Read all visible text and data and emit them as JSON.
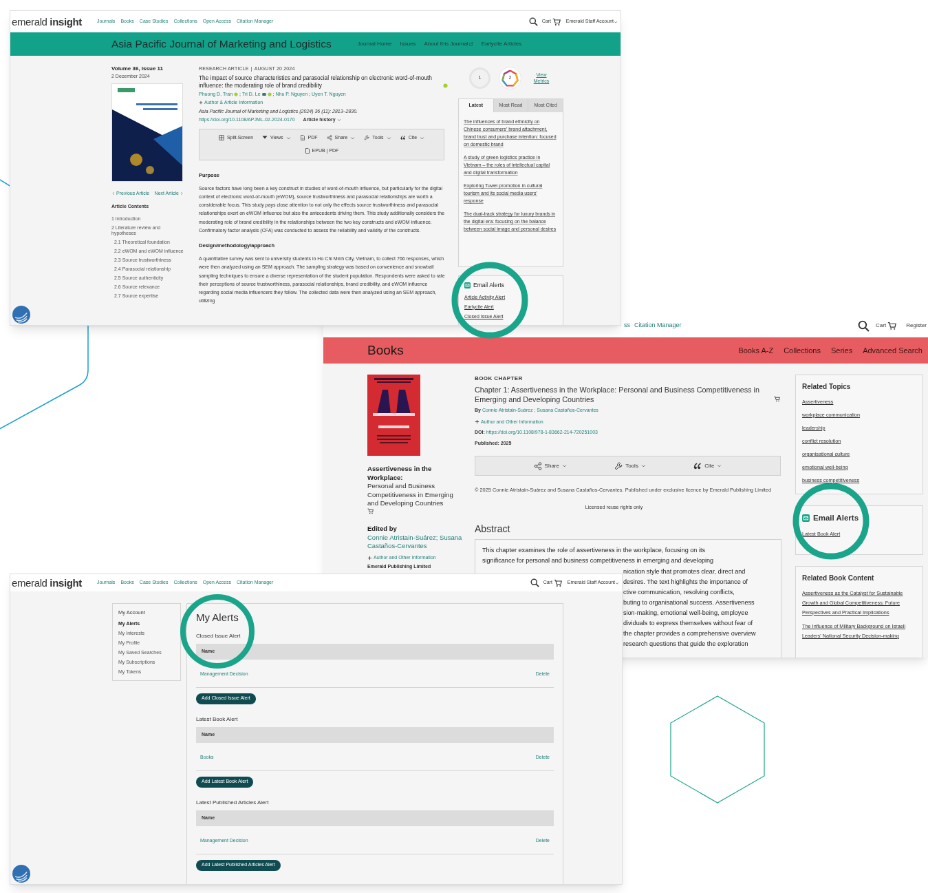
{
  "journal_window": {
    "header": {
      "logo": "emerald **insight**",
      "nav": [
        "Journals",
        "Books",
        "Case Studies",
        "Collections",
        "Open Access",
        "Citation Manager"
      ],
      "cart": "Cart",
      "account": "Emerald Staff Account"
    },
    "banner": {
      "title": "Asia Pacific Journal of Marketing and Logistics",
      "nav": [
        {
          "label": "Journal Home",
          "external": false
        },
        {
          "label": "Issues",
          "external": false
        },
        {
          "label": "About this Journal",
          "external": true
        },
        {
          "label": "Earlycite Articles",
          "external": false
        }
      ]
    },
    "issue": {
      "volume": "Volume 36, Issue 11",
      "date": "2 December 2024"
    },
    "article_nav": {
      "previous": "Previous Article",
      "next": "Next Article"
    },
    "contents": {
      "heading": "Article Contents",
      "items": [
        {
          "label": "1 Introduction"
        },
        {
          "label": "2 Literature review and hypotheses",
          "children": [
            {
              "label": "2.1 Theoretical foundation"
            },
            {
              "label": "2.2 eWOM and eWOM influence"
            },
            {
              "label": "2.3 Source trustworthiness"
            },
            {
              "label": "2.4 Parasocial relationship"
            },
            {
              "label": "2.5 Source authenticity"
            },
            {
              "label": "2.6 Source relevance"
            },
            {
              "label": "2.7 Source expertise"
            }
          ]
        }
      ]
    },
    "article": {
      "type": "RESEARCH ARTICLE",
      "divider": "|",
      "date": "AUGUST 20 2024",
      "title": "The impact of source characteristics and parasocial relationship on electronic word-of-mouth influence: the moderating role of brand credibility",
      "authors": [
        {
          "name": "Phuong D. Tran",
          "orcid": true,
          "email": false,
          "separator": ";"
        },
        {
          "name": "Tri D. Le",
          "orcid": true,
          "email": true,
          "separator": ";"
        },
        {
          "name": "Nhu P. Nguyen",
          "orcid": false,
          "email": false,
          "separator": ";"
        },
        {
          "name": "Uyen T. Nguyen",
          "orcid": false,
          "email": false
        }
      ],
      "author_info": "Author & Article Information",
      "citation": "Asia Pacific Journal of Marketing and Logistics (2024) 36 (11): 2813–2830.",
      "doi": "https://doi.org/10.1108/APJML-02-2024-0170",
      "history": "Article history",
      "toolbar": [
        {
          "kind": "split",
          "label": "Split-Screen",
          "dropdown": false
        },
        {
          "kind": "views",
          "label": "Views",
          "dropdown": true
        },
        {
          "kind": "pdf",
          "label": "PDF",
          "dropdown": false
        },
        {
          "kind": "share",
          "label": "Share",
          "dropdown": true
        },
        {
          "kind": "tools",
          "label": "Tools",
          "dropdown": true
        },
        {
          "kind": "cite",
          "label": "Cite",
          "dropdown": true
        }
      ],
      "formats": "EPUB | PDF",
      "sections": [
        {
          "heading": "Purpose",
          "text": "Source factors have long been a key construct in studies of word-of-mouth influence, but particularly for the digital context of electronic word-of-mouth (eWOM), source trustworthiness and parasocial relationships are worth a considerable focus. This study pays close attention to not only the effects source trustworthiness and parasocial relationships exert on eWOM influence but also the antecedents driving them. This study additionally considers the moderating role of brand credibility in the relationships between the two key constructs and eWOM influence. Confirmatory factor analysis (CFA) was conducted to assess the reliability and validity of the constructs."
        },
        {
          "heading": "Design/methodology/approach",
          "text": "A quantitative survey was sent to university students in Ho Chi Minh City, Vietnam, to collect 766 responses, which were then analyzed using an SEM approach. The sampling strategy was based on convenience and snowball sampling techniques to ensure a diverse representation of the student population. Respondents were asked to rate their perceptions of source trustworthiness, parasocial relationships, brand credibility, and eWOM influence regarding social media influencers they follow. The collected data were then analyzed using an SEM approach, utilizing"
        }
      ]
    },
    "metrics": {
      "citations": "1",
      "attention": "2",
      "link": "View Metrics"
    },
    "tabs": [
      {
        "label": "Latest",
        "selected": true
      },
      {
        "label": "Most Read",
        "selected": false
      },
      {
        "label": "Most Cited",
        "selected": false
      }
    ],
    "latest": [
      "The influences of brand ethnicity on Chinese consumers' brand attachment, brand trust and purchase intention: focused on domestic brand",
      "A study of green logistics practice in Vietnam – the roles of intellectual capital and digital transformation",
      "Exploring Tuwei promotion in cultural tourism and its social media users' response",
      "The dual-track strategy for luxury brands in the digital era: focusing on the balance between social image and personal desires"
    ],
    "email_alerts": {
      "title": "Email Alerts",
      "links": [
        "Article Activity Alert",
        "Earlycite Alert",
        "Closed Issue Alert"
      ]
    }
  },
  "books_window": {
    "header": {
      "nav": [
        "ss",
        "Citation Manager"
      ],
      "cart": "Cart",
      "account": "Register"
    },
    "banner": {
      "title": "Books",
      "nav": [
        "Books A-Z",
        "Collections",
        "Series",
        "Advanced Search"
      ]
    },
    "book": {
      "title": "Assertiveness in the Workplace:",
      "subtitle": "Personal and Business Competitiveness in Emerging and Developing Countries",
      "edited_by": "Edited by",
      "editors": "Connie Atristain-Suárez; Susana Castaños-Cervantes",
      "author_info": "Author and Other Information",
      "publisher": "Emerald Publishing Limited"
    },
    "chapter": {
      "type": "BOOK CHAPTER",
      "title": "Chapter 1: Assertiveness in the Workplace: Personal and Business Competitiveness in Emerging and Developing Countries",
      "by": "By",
      "authors": "Connie Atristain-Suárez ; Susana Castaños-Cervantes",
      "author_info": "Author and Other Information",
      "doi_label": "DOI:",
      "doi": "https://doi.org/10.1108/978-1-83662-214-720251003",
      "published_label": "Published:",
      "published": "2025",
      "toolbar": [
        {
          "kind": "share",
          "label": "Share",
          "dropdown": true
        },
        {
          "kind": "tools",
          "label": "Tools",
          "dropdown": true
        },
        {
          "kind": "cite",
          "label": "Cite",
          "dropdown": true
        }
      ],
      "copyright": "© 2025 Connie Atristain-Suárez and Susana Castaños-Cervantes. Published under exclusive licence by Emerald Publishing Limited",
      "licence": "Licensed reuse rights only",
      "abstract_heading": "Abstract",
      "abstract_lines": [
        "This chapter examines the role of assertiveness in the workplace, focusing on its",
        "significance for personal and business competitiveness in emerging and developing"
      ],
      "abstract_visible_fragments": [
        "nication style that promotes clear, direct and",
        "desires. The text highlights the importance of",
        "ctive communication, resolving conflicts,",
        "buting to organisational success. Assertiveness",
        "sion-making, emotional well-being, employee",
        "dividuals to express themselves without fear of",
        "the chapter provides a comprehensive overview",
        "research questions that guide the exploration"
      ]
    },
    "related_topics": {
      "title": "Related Topics",
      "links": [
        "Assertiveness",
        "workplace communication",
        "leadership",
        "conflict resolution",
        "organisational culture",
        "emotional well-being",
        "business competitiveness"
      ]
    },
    "email_alerts": {
      "title": "Email Alerts",
      "links": [
        "Latest Book Alert"
      ]
    },
    "related_content": {
      "title": "Related Book Content",
      "links": [
        "Assertiveness as the Catalyst for Sustainable Growth and Global Competitiveness: Future Perspectives and Practical Implications",
        "The Influence of Military Background on Israeli Leaders' National Security Decision-making"
      ]
    }
  },
  "alerts_window": {
    "header": {
      "logo": "emerald **insight**",
      "nav": [
        "Journals",
        "Books",
        "Case Studies",
        "Collections",
        "Open Access",
        "Citation Manager"
      ],
      "cart": "Cart",
      "account": "Emerald Staff Account"
    },
    "sidebar": {
      "title": "My Account",
      "items": [
        {
          "label": "My Alerts",
          "selected": true
        },
        {
          "label": "My Interests",
          "selected": false
        },
        {
          "label": "My Profile",
          "selected": false
        },
        {
          "label": "My Saved Searches",
          "selected": false
        },
        {
          "label": "My Subscriptions",
          "selected": false
        },
        {
          "label": "My Tokens",
          "selected": false
        }
      ]
    },
    "title": "My Alerts",
    "sections": [
      {
        "title": "Closed Issue Alert",
        "column": "Name",
        "rows": [
          {
            "name": "Management Decision",
            "action": "Delete"
          }
        ],
        "button": "Add Closed Issue Alert"
      },
      {
        "title": "Latest Book Alert",
        "column": "Name",
        "rows": [
          {
            "name": "Books",
            "action": "Delete"
          }
        ],
        "button": "Add Latest Book Alert"
      },
      {
        "title": "Latest Published Articles Alert",
        "column": "Name",
        "rows": [
          {
            "name": "Management Decision",
            "action": "Delete"
          }
        ],
        "button": "Add Latest Published Articles Alert"
      }
    ]
  }
}
